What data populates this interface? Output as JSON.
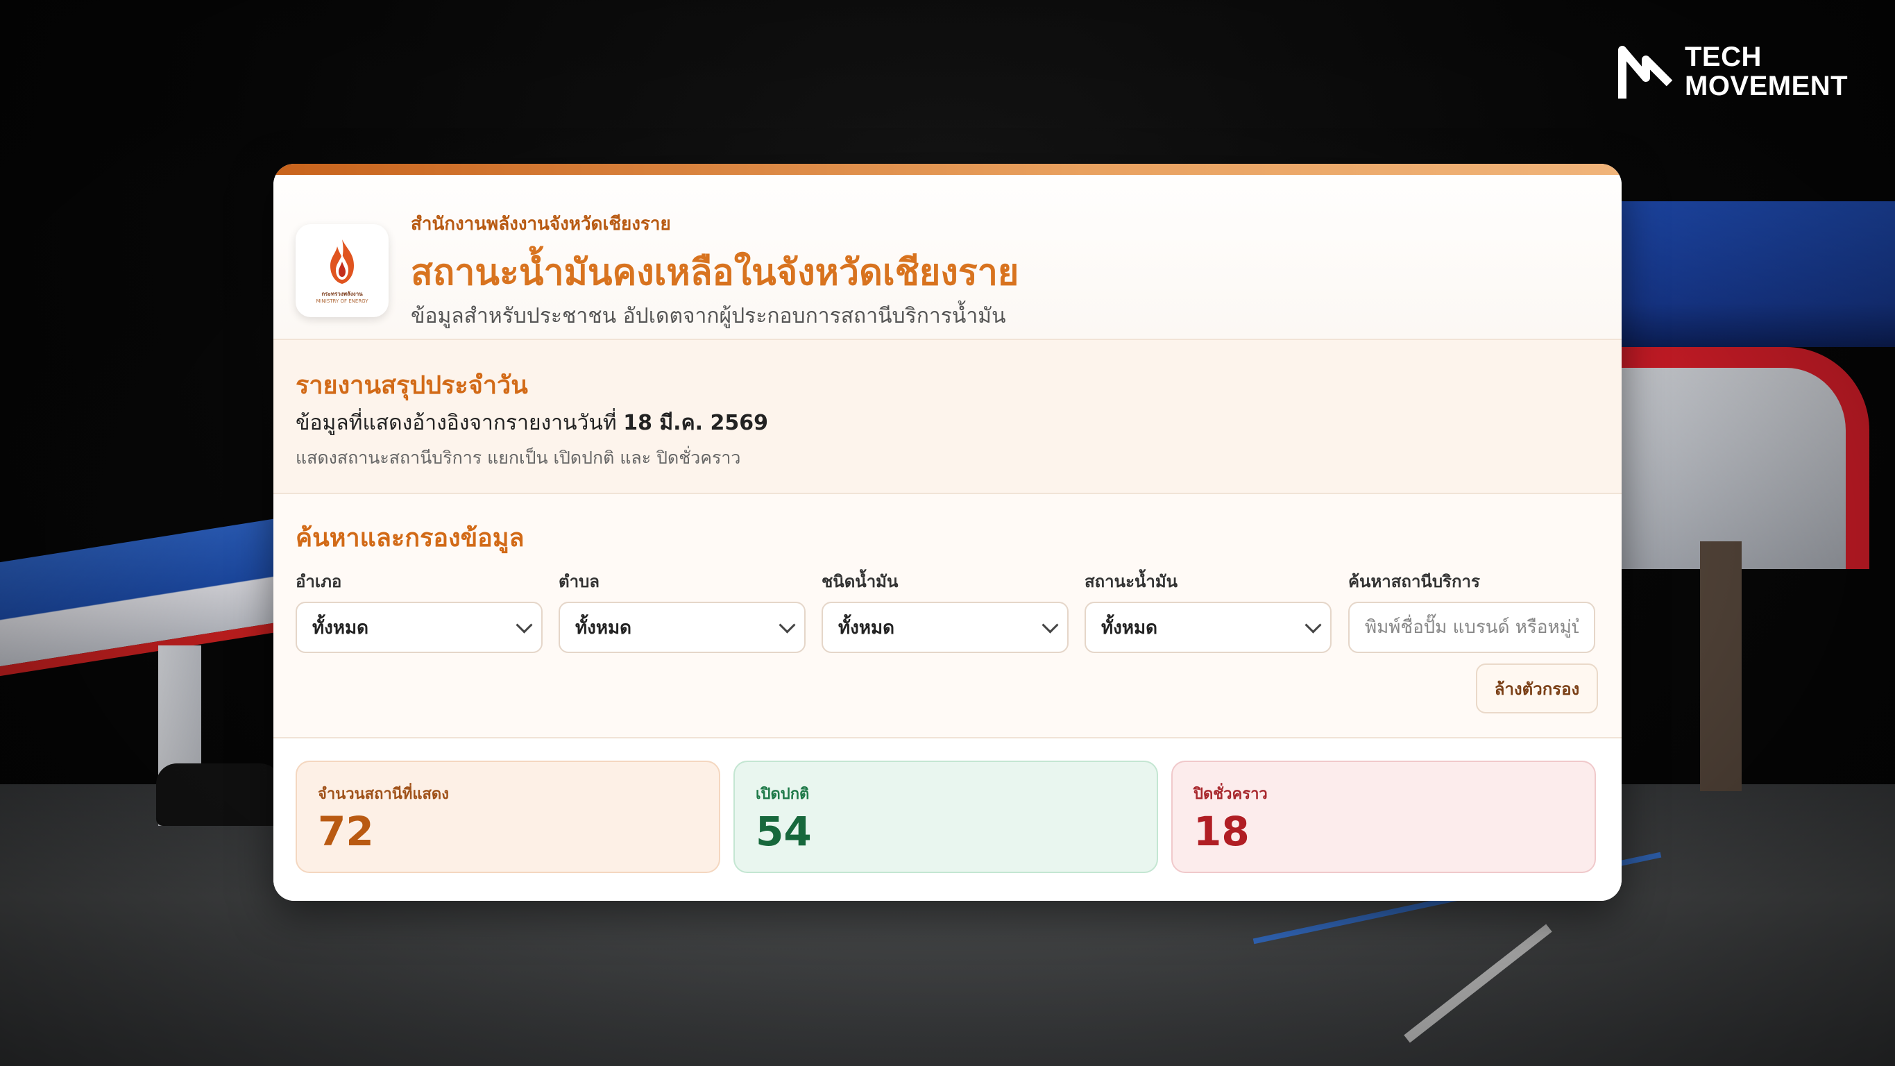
{
  "brand": {
    "line1": "TECH",
    "line2": "MOVEMENT"
  },
  "header": {
    "logo_caption_th": "กระทรวงพลังงาน",
    "logo_caption_en": "MINISTRY OF ENERGY",
    "org": "สำนักงานพลังงานจังหวัดเชียงราย",
    "title": "สถานะน้ำมันคงเหลือในจังหวัดเชียงราย",
    "subtitle": "ข้อมูลสำหรับประชาชน อัปเดตจากผู้ประกอบการสถานีบริการน้ำมัน"
  },
  "report": {
    "heading": "รายงานสรุปประจำวัน",
    "reference_prefix": "ข้อมูลที่แสดงอ้างอิงจากรายงานวันที่",
    "reference_date": "18 มี.ค. 2569",
    "note": "แสดงสถานะสถานีบริการ แยกเป็น เปิดปกติ และ ปิดชั่วคราว"
  },
  "filter": {
    "heading": "ค้นหาและกรองข้อมูล",
    "fields": [
      {
        "label": "อำเภอ",
        "value": "ทั้งหมด"
      },
      {
        "label": "ตำบล",
        "value": "ทั้งหมด"
      },
      {
        "label": "ชนิดน้ำมัน",
        "value": "ทั้งหมด"
      },
      {
        "label": "สถานะน้ำมัน",
        "value": "ทั้งหมด"
      }
    ],
    "search": {
      "label": "ค้นหาสถานีบริการ",
      "placeholder": "พิมพ์ชื่อปั๊ม แบรนด์ หรือหมู่บ้าน"
    },
    "clear_label": "ล้างตัวกรอง"
  },
  "stats": {
    "total": {
      "label": "จำนวนสถานีที่แสดง",
      "value": "72"
    },
    "open": {
      "label": "เปิดปกติ",
      "value": "54"
    },
    "closed": {
      "label": "ปิดชั่วคราว",
      "value": "18"
    }
  }
}
